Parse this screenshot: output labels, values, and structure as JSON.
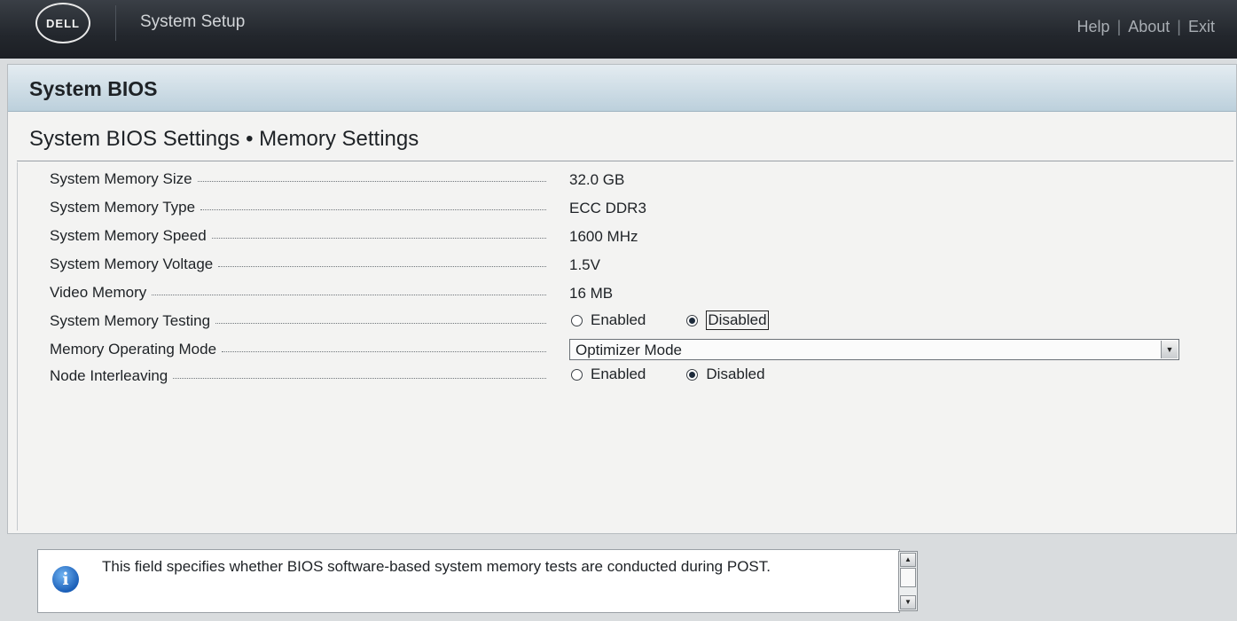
{
  "header": {
    "logo": "DELL",
    "app_title": "System Setup",
    "links": [
      "Help",
      "About",
      "Exit"
    ],
    "separator": "|"
  },
  "panel": {
    "title": "System BIOS",
    "section_title": "System BIOS Settings • Memory Settings"
  },
  "settings": [
    {
      "label": "System Memory Size",
      "value": "32.0 GB"
    },
    {
      "label": "System Memory Type",
      "value": "ECC DDR3"
    },
    {
      "label": "System Memory Speed",
      "value": "1600 MHz"
    },
    {
      "label": "System Memory Voltage",
      "value": "1.5V"
    },
    {
      "label": "Video Memory",
      "value": "16 MB"
    },
    {
      "label": "System Memory Testing",
      "options": [
        "Enabled",
        "Disabled"
      ],
      "selected": "Disabled"
    },
    {
      "label": "Memory Operating Mode",
      "select_value": "Optimizer Mode"
    },
    {
      "label": "Node Interleaving",
      "options": [
        "Enabled",
        "Disabled"
      ],
      "selected": "Disabled"
    }
  ],
  "info": {
    "icon": "info-icon",
    "text": "This field specifies whether BIOS software-based system memory tests are conducted during POST."
  }
}
